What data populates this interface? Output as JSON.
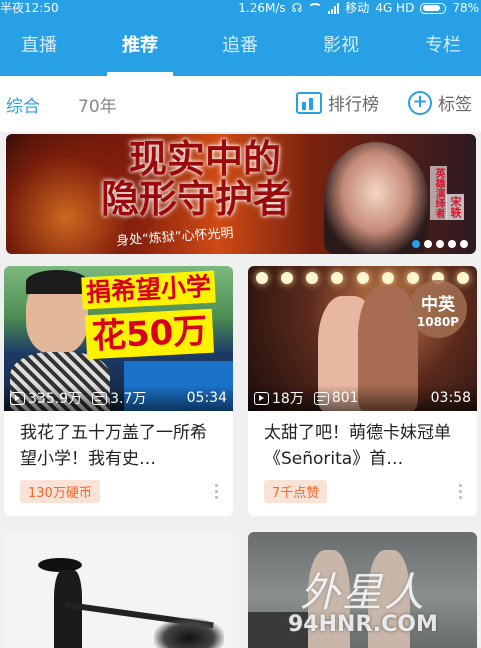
{
  "status_bar": {
    "time": "半夜12:50",
    "speed": "1.26M/s",
    "carrier": "移动",
    "network": "4G HD",
    "battery": "78%"
  },
  "top_tabs": [
    {
      "label": "直播"
    },
    {
      "label": "推荐"
    },
    {
      "label": "追番"
    },
    {
      "label": "影视"
    },
    {
      "label": "专栏"
    }
  ],
  "sub_bar": {
    "tab_all": "综合",
    "tab_70": "70年",
    "ranking_label": "排行榜",
    "tags_label": "标签"
  },
  "banner": {
    "title_line1": "现实中的",
    "title_line2": "隐形守护者",
    "subtitle": "身处“炼狱”心怀光明",
    "note": "英雄演绎者",
    "name": "宋轶",
    "dots": 5,
    "active_dot": 0
  },
  "cards": [
    {
      "thumb_caption1": "捐希望小学",
      "thumb_caption2": "花50万",
      "views": "335.9万",
      "danmaku": "3.7万",
      "duration": "05:34",
      "title": "我花了五十万盖了一所希望小学！我有史…",
      "badge": "130万硬币"
    },
    {
      "thumb_badge_top": "中英",
      "thumb_badge_bottom": "1080P",
      "views": "18万",
      "danmaku": "801",
      "duration": "03:58",
      "title": "太甜了吧！萌德卡妹冠单《Señorita》首…",
      "badge": "7千点赞"
    }
  ],
  "watermark": {
    "text": "外星人",
    "url": "94HNR.COM"
  },
  "colors": {
    "brand": "#28a0e6",
    "badge_text": "#f26a2a",
    "badge_bg": "#fbe2d6"
  }
}
